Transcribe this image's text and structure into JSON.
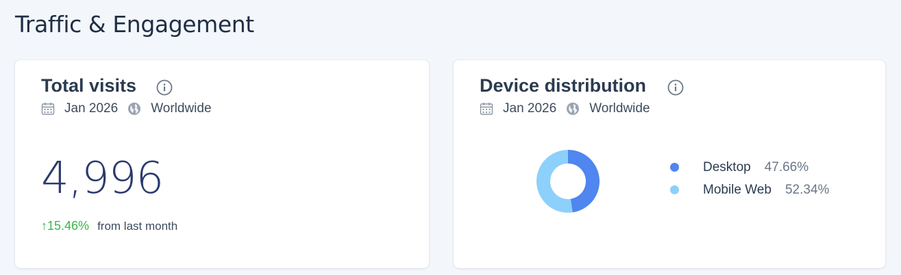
{
  "section": {
    "title": "Traffic & Engagement"
  },
  "visits_card": {
    "title": "Total visits",
    "date": "Jan 2026",
    "region": "Worldwide",
    "value": "4,996",
    "change": "15.46%",
    "change_label": "from last month",
    "change_color": "#3bb54a"
  },
  "device_card": {
    "title": "Device distribution",
    "date": "Jan 2026",
    "region": "Worldwide",
    "legend": [
      {
        "name": "Desktop",
        "value": "47.66%",
        "color": "#4f86ef"
      },
      {
        "name": "Mobile Web",
        "value": "52.34%",
        "color": "#8dd0fb"
      }
    ]
  },
  "chart_data": {
    "type": "pie",
    "categories": [
      "Desktop",
      "Mobile Web"
    ],
    "values": [
      47.66,
      52.34
    ],
    "colors": [
      "#4f86ef",
      "#8dd0fb"
    ],
    "donut": true,
    "legend_position": "right"
  },
  "icons": {
    "info": "info-icon",
    "calendar": "calendar-icon",
    "globe": "globe-icon",
    "up_arrow": "arrow-up-icon"
  }
}
